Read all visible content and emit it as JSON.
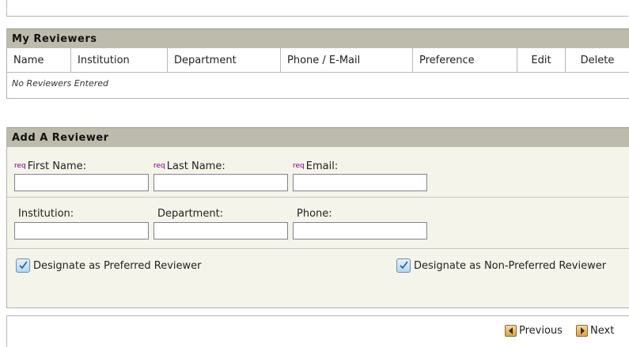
{
  "my_reviewers": {
    "title": "My Reviewers",
    "columns": [
      "Name",
      "Institution",
      "Department",
      "Phone / E-Mail",
      "Preference",
      "Edit",
      "Delete"
    ],
    "empty_message": "No Reviewers Entered"
  },
  "add_reviewer": {
    "title": "Add A Reviewer",
    "req_marker": "req",
    "first_name_label": "First Name:",
    "last_name_label": "Last Name:",
    "email_label": "Email:",
    "institution_label": "Institution:",
    "department_label": "Department:",
    "phone_label": "Phone:",
    "first_name_value": "",
    "last_name_value": "",
    "email_value": "",
    "institution_value": "",
    "department_value": "",
    "phone_value": "",
    "preferred_label": "Designate as Preferred Reviewer",
    "non_preferred_label": "Designate as Non-Preferred Reviewer"
  },
  "nav": {
    "previous_label": "Previous",
    "next_label": "Next"
  }
}
